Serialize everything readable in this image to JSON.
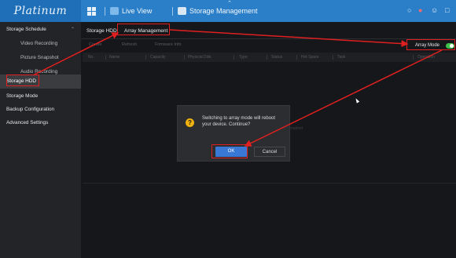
{
  "header": {
    "brand": "Platinum",
    "nav": [
      {
        "label": "Live View"
      },
      {
        "label": "Storage Management"
      }
    ]
  },
  "sidebar": {
    "items": [
      {
        "label": "Storage Schedule",
        "type": "group",
        "expanded": true
      },
      {
        "label": "Video Recording",
        "type": "child"
      },
      {
        "label": "Picture Snapshot",
        "type": "child"
      },
      {
        "label": "Audio Recording",
        "type": "child"
      },
      {
        "label": "Storage HDD",
        "type": "group",
        "active": true
      },
      {
        "label": "Storage Mode",
        "type": "group"
      },
      {
        "label": "Backup Configuration",
        "type": "group"
      },
      {
        "label": "Advanced Settings",
        "type": "group"
      }
    ]
  },
  "main": {
    "tabs": [
      {
        "label": "Storage HDD"
      },
      {
        "label": "Array Management",
        "active": true
      }
    ],
    "toolbar": {
      "buttons": [
        "Create",
        "Refresh",
        "Firmware Info"
      ],
      "array_mode_label": "Array Mode",
      "array_mode_on": true
    },
    "table": {
      "columns": [
        "No.",
        "Name",
        "Capacity",
        "Physical Disk",
        "Type",
        "Status",
        "Hot Spare",
        "Task",
        "Operation"
      ]
    },
    "ghost_text": "mode is not enabled"
  },
  "dialog": {
    "message": "Switching to array mode will reboot your device. Continue?",
    "ok_label": "OK",
    "cancel_label": "Cancel"
  },
  "colors": {
    "topbar": "#2b7fc9",
    "accent": "#3a78d6",
    "highlight": "#e02020",
    "toggle_on": "#3fc24a",
    "warning_icon": "#f0b20e"
  }
}
